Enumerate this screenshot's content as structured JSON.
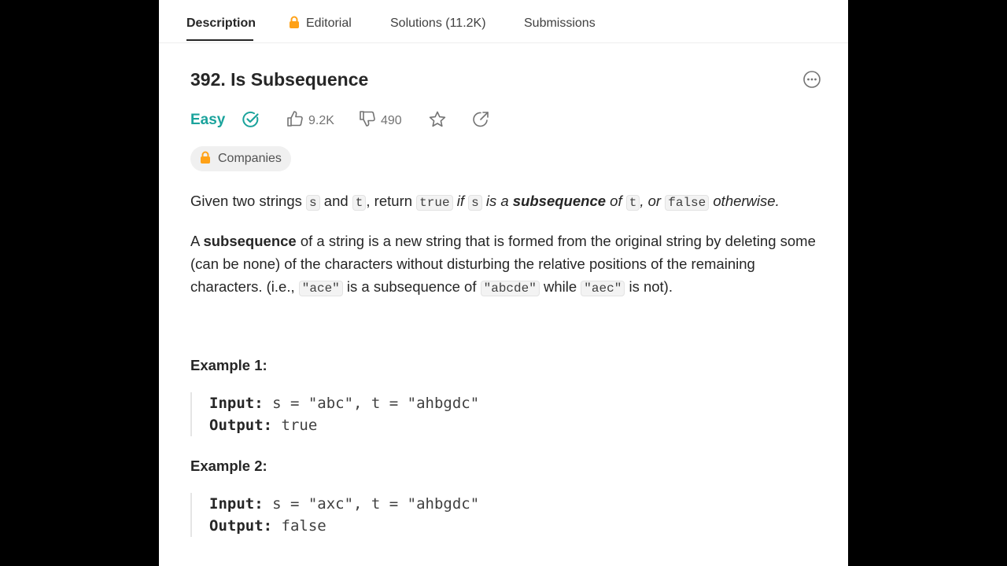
{
  "tabs": {
    "description": "Description",
    "editorial": "Editorial",
    "solutions": "Solutions (11.2K)",
    "submissions": "Submissions"
  },
  "problem": {
    "title": "392. Is Subsequence",
    "difficulty": "Easy",
    "likes": "9.2K",
    "dislikes": "490",
    "companies_label": "Companies"
  },
  "description": {
    "p1": {
      "t1": "Given two strings ",
      "c1": "s",
      "t2": " and ",
      "c2": "t",
      "t3": ", return ",
      "c3": "true",
      "t4": " if ",
      "c4": "s",
      "t5": " is a ",
      "b1": "subsequence",
      "t6": " of ",
      "c5": "t",
      "t7": ", or ",
      "c6": "false",
      "t8": " otherwise."
    },
    "p2": {
      "t1": "A ",
      "b1": "subsequence",
      "t2": " of a string is a new string that is formed from the original string by deleting some (can be none) of the characters without disturbing the relative positions of the remaining characters. (i.e., ",
      "c1": "\"ace\"",
      "t3": " is a subsequence of ",
      "c2": "\"abcde\"",
      "t4": " while ",
      "c3": "\"aec\"",
      "t5": " is not)."
    }
  },
  "examples": [
    {
      "title": "Example 1:",
      "input_label": "Input:",
      "input_value": " s = \"abc\", t = \"ahbgdc\"",
      "output_label": "Output:",
      "output_value": " true"
    },
    {
      "title": "Example 2:",
      "input_label": "Input:",
      "input_value": " s = \"axc\", t = \"ahbgdc\"",
      "output_label": "Output:",
      "output_value": " false"
    }
  ],
  "colors": {
    "easy": "#1ba39c",
    "lock": "#ffa116"
  },
  "icons": [
    "lock-icon",
    "more-icon",
    "solved-check-icon",
    "thumbs-up-icon",
    "thumbs-down-icon",
    "star-icon",
    "share-icon"
  ]
}
